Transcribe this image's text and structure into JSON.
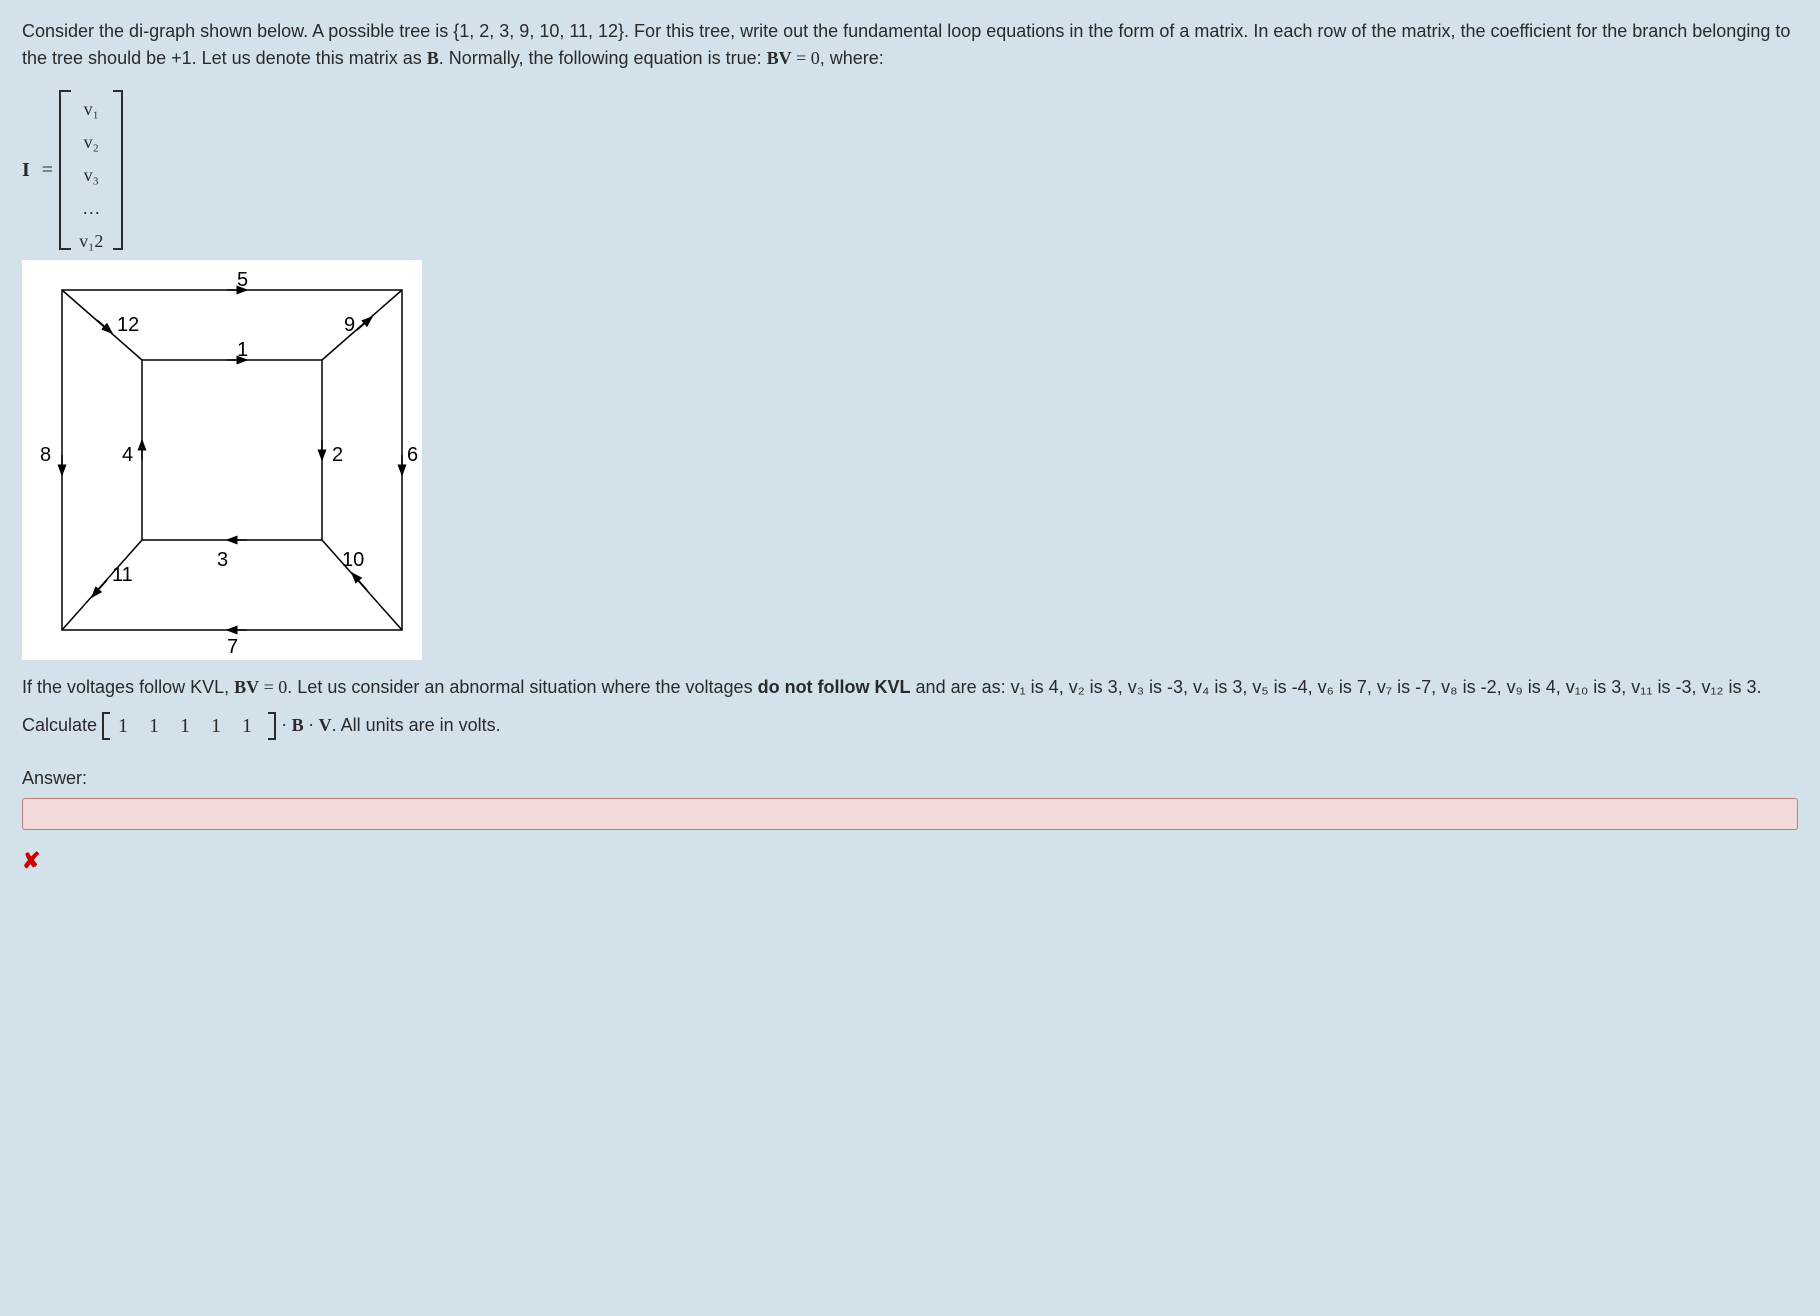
{
  "intro": {
    "p1a": "Consider the di-graph shown below. A possible tree is {1, 2, 3, 9, 10, 11, 12}. For this tree, write out the fundamental loop equations in the form of a matrix. In each row of the matrix, the coefficient for the branch belonging to the tree should be +1. Let us denote this matrix as ",
    "B": "B",
    "p1b": ". Normally, the following equation is true: ",
    "BV": "BV",
    "eq0": " = 0",
    "p1c": ", where:"
  },
  "vector": {
    "label": "I",
    "eq": "=",
    "entries": [
      "v₁",
      "v₂",
      "v₃",
      "…",
      "v₁2"
    ]
  },
  "graph": {
    "labels": {
      "e1": "1",
      "e2": "2",
      "e3": "3",
      "e4": "4",
      "e5": "5",
      "e6": "6",
      "e7": "7",
      "e8": "8",
      "e9": "9",
      "e10": "10",
      "e11": "11",
      "e12": "12"
    }
  },
  "p2": {
    "a": "If the voltages follow KVL, ",
    "BV": "BV",
    "eq0": " = 0",
    "b": ". Let us consider an abnormal situation where the voltages ",
    "bold": "do not follow KVL",
    "c": " and are as: v₁ is 4, v₂ is 3, v₃ is -3, v₄ is 3, v₅ is -4, v₆ is 7, v₇ is -7, v₈ is -2, v₉ is 4, v₁₀ is 3, v₁₁ is -3, v₁₂ is 3."
  },
  "calc": {
    "a": "Calculate ",
    "row": "1 1 1 1 1",
    "dot": " · ",
    "B": "B",
    "V": "V",
    "b": ". All units are in volts."
  },
  "answer": {
    "label": "Answer:",
    "value": ""
  },
  "x": "✘"
}
